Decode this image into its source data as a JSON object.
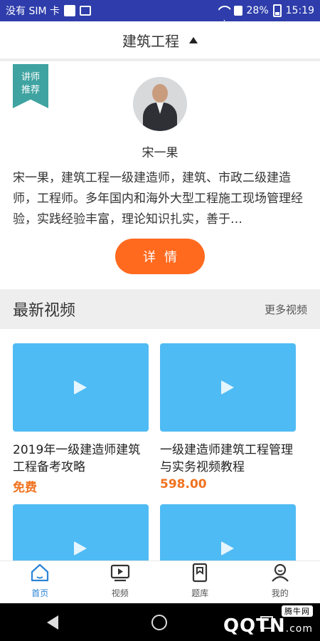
{
  "status_bar": {
    "carrier": "没有 SIM 卡",
    "battery": "28%",
    "time": "15:19"
  },
  "header": {
    "title": "建筑工程"
  },
  "teacher": {
    "badge_line1": "讲师",
    "badge_line2": "推荐",
    "name": "宋一果",
    "description": "宋一果，建筑工程一级建造师，建筑、市政二级建造师，工程师。多年国内和海外大型工程施工现场管理经验，实践经验丰富，理论知识扎实，善于…",
    "detail_button": "详情"
  },
  "latest_videos": {
    "heading": "最新视频",
    "more": "更多视频",
    "items": [
      {
        "title": "2019年一级建造师建筑工程备考攻略",
        "price": "免费"
      },
      {
        "title": "一级建造师建筑工程管理与实务视频教程",
        "price": "598.00"
      },
      {
        "title": "",
        "price": ""
      },
      {
        "title": "",
        "price": ""
      }
    ]
  },
  "bottom_nav": [
    {
      "label": "首页",
      "icon": "home-icon",
      "active": true
    },
    {
      "label": "视频",
      "icon": "video-icon",
      "active": false
    },
    {
      "label": "题库",
      "icon": "question-bank-icon",
      "active": false
    },
    {
      "label": "我的",
      "icon": "profile-icon",
      "active": false
    }
  ],
  "watermark": {
    "text": "QQTN",
    "suffix": ".com",
    "tag": "腾牛网"
  },
  "colors": {
    "status_bar": "#2e3dab",
    "accent_orange": "#ff6a1f",
    "price_orange": "#f07320",
    "thumb_blue": "#4fbbf4",
    "ribbon_teal": "#3fa3a1",
    "nav_active": "#2b84d6"
  }
}
